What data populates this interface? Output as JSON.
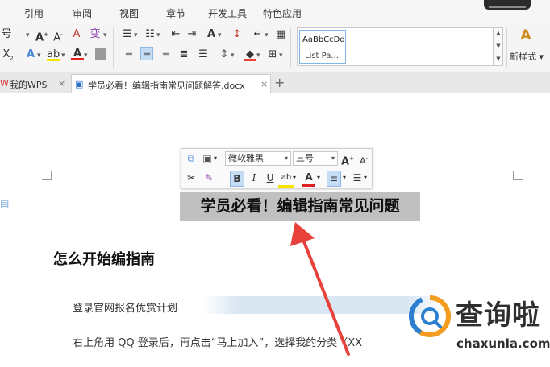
{
  "menu": {
    "items": [
      "引用",
      "审阅",
      "视图",
      "章节",
      "开发工具",
      "特色应用"
    ]
  },
  "ribbon": {
    "style_preview": {
      "sample": "AaBbCcDd",
      "name": "List Pa..."
    },
    "new_style_label": "新样式",
    "dropdown_arrow": "▾"
  },
  "tabs": [
    {
      "label": "我的WPS",
      "close": "×"
    },
    {
      "label": "学员必看！编辑指南常见问题解答.docx",
      "close": "×"
    }
  ],
  "add_tab": "+",
  "mini_toolbar": {
    "font": "微软雅黑",
    "size": "三号",
    "grow_label": "A",
    "shrink_label": "A",
    "bold_label": "B",
    "italic_label": "I",
    "underline_label": "U",
    "font_color_label": "A"
  },
  "document": {
    "title": "学员必看！编辑指南常见问题",
    "heading": "怎么开始编指南",
    "para1": "登录官网报名优赏计划",
    "para2": "右上角用 QQ 登录后，再点击“马上加入”，选择我的分类（XX"
  },
  "watermark": {
    "name": "查询啦",
    "domain": "chaxunla.com"
  },
  "colors": {
    "accent_blue": "#4c8ad8",
    "arrow_red": "#e8403a",
    "highlight_gray": "#c0c0c0",
    "logo_orange": "#f39c1f",
    "logo_blue": "#2d7fd0"
  }
}
